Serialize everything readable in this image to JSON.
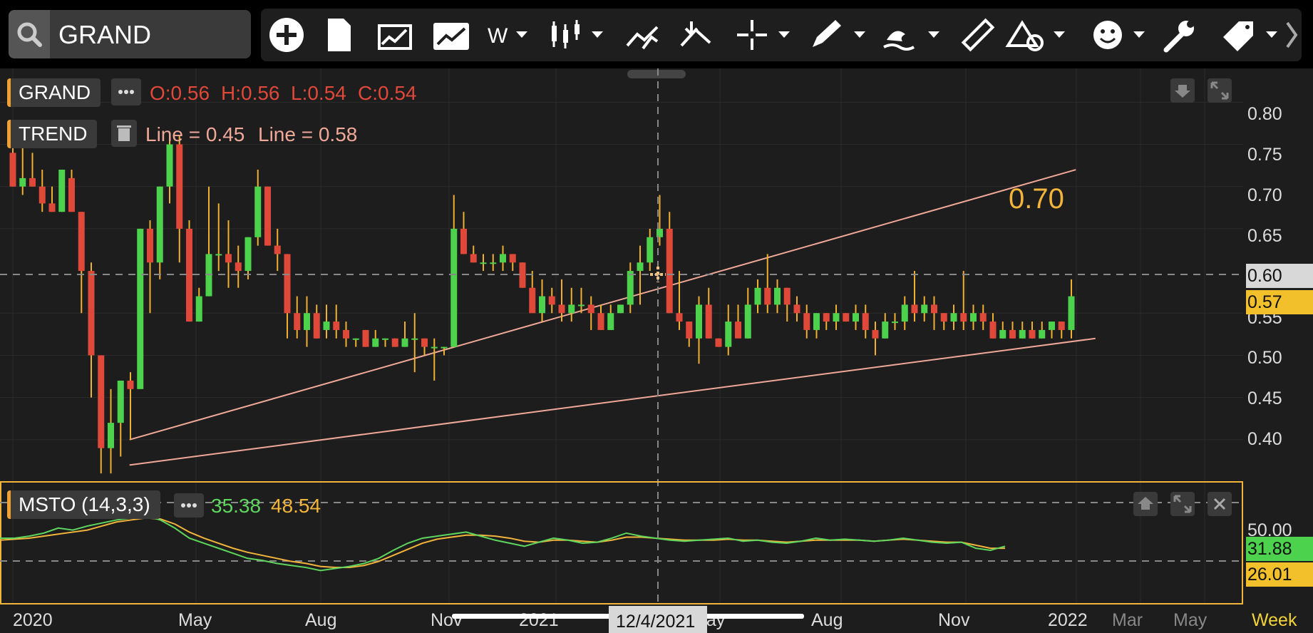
{
  "search": {
    "value": "GRAND"
  },
  "toolbar": {
    "interval": "W",
    "icons": [
      "add-icon",
      "new-document-icon",
      "compare-icon",
      "chart-overlay-icon",
      "interval-dropdown",
      "candlestick-icon",
      "indicator-icon",
      "drawing-icon",
      "crosshair-icon",
      "pencil-icon",
      "wave-icon",
      "ruler-icon",
      "shapes-icon",
      "emoji-icon",
      "wrench-icon",
      "tag-icon",
      "chevron-right-icon"
    ]
  },
  "main_legend": {
    "symbol": "GRAND",
    "open": "O:0.56",
    "high": "H:0.56",
    "low": "L:0.54",
    "close": "C:0.54"
  },
  "trend_legend": {
    "name": "TREND",
    "line1": "Line = 0.45",
    "line2": "Line = 0.58"
  },
  "annotation": "0.70",
  "price_axis": {
    "ticks": [
      "0.80",
      "0.75",
      "0.70",
      "0.65",
      "0.60",
      "0.55",
      "0.50",
      "0.45",
      "0.40"
    ],
    "crosshair_label": "0.60",
    "last_price": "0.57"
  },
  "indicator": {
    "name": "MSTO (14,3,3)",
    "k": "35.38",
    "d": "48.54",
    "axis_tick": "50.00",
    "k_last": "31.88",
    "d_last": "26.01"
  },
  "time_axis": {
    "labels": [
      "2020",
      "May",
      "Aug",
      "Nov",
      "2021",
      "May",
      "Aug",
      "Nov",
      "2022",
      "Mar",
      "May"
    ],
    "crosshair_date": "12/4/2021",
    "period": "Week"
  },
  "colors": {
    "up": "#4cd24c",
    "down": "#e0483a",
    "wick": "#f0b030",
    "trend_line": "#f0a898",
    "stoch_k": "#5ed65e",
    "stoch_d": "#f2b43a",
    "accent": "#f2b43a"
  },
  "chart_data": {
    "type": "candlestick",
    "ylim": [
      0.35,
      0.84
    ],
    "candles": [
      [
        0.74,
        0.77,
        0.7,
        0.7
      ],
      [
        0.7,
        0.75,
        0.69,
        0.71
      ],
      [
        0.71,
        0.74,
        0.7,
        0.7
      ],
      [
        0.7,
        0.72,
        0.67,
        0.68
      ],
      [
        0.68,
        0.7,
        0.67,
        0.67
      ],
      [
        0.67,
        0.72,
        0.67,
        0.72
      ],
      [
        0.71,
        0.72,
        0.67,
        0.67
      ],
      [
        0.67,
        0.67,
        0.55,
        0.6
      ],
      [
        0.6,
        0.61,
        0.45,
        0.5
      ],
      [
        0.5,
        0.45,
        0.36,
        0.39
      ],
      [
        0.39,
        0.46,
        0.36,
        0.42
      ],
      [
        0.42,
        0.47,
        0.38,
        0.47
      ],
      [
        0.47,
        0.48,
        0.4,
        0.46
      ],
      [
        0.46,
        0.65,
        0.46,
        0.65
      ],
      [
        0.65,
        0.66,
        0.55,
        0.61
      ],
      [
        0.61,
        0.7,
        0.59,
        0.7
      ],
      [
        0.7,
        0.76,
        0.68,
        0.75
      ],
      [
        0.75,
        0.76,
        0.61,
        0.65
      ],
      [
        0.65,
        0.66,
        0.54,
        0.54
      ],
      [
        0.54,
        0.58,
        0.54,
        0.57
      ],
      [
        0.57,
        0.7,
        0.57,
        0.62
      ],
      [
        0.62,
        0.68,
        0.6,
        0.62
      ],
      [
        0.62,
        0.66,
        0.58,
        0.61
      ],
      [
        0.61,
        0.63,
        0.58,
        0.6
      ],
      [
        0.6,
        0.64,
        0.59,
        0.64
      ],
      [
        0.64,
        0.72,
        0.63,
        0.7
      ],
      [
        0.7,
        0.7,
        0.63,
        0.63
      ],
      [
        0.63,
        0.65,
        0.6,
        0.62
      ],
      [
        0.62,
        0.62,
        0.52,
        0.55
      ],
      [
        0.55,
        0.57,
        0.52,
        0.53
      ],
      [
        0.53,
        0.57,
        0.51,
        0.55
      ],
      [
        0.55,
        0.56,
        0.52,
        0.52
      ],
      [
        0.53,
        0.56,
        0.52,
        0.54
      ],
      [
        0.54,
        0.56,
        0.52,
        0.53
      ],
      [
        0.53,
        0.54,
        0.51,
        0.52
      ],
      [
        0.52,
        0.52,
        0.51,
        0.52
      ],
      [
        0.53,
        0.53,
        0.51,
        0.51
      ],
      [
        0.51,
        0.53,
        0.51,
        0.52
      ],
      [
        0.52,
        0.52,
        0.51,
        0.52
      ],
      [
        0.52,
        0.52,
        0.51,
        0.51
      ],
      [
        0.51,
        0.54,
        0.51,
        0.52
      ],
      [
        0.52,
        0.55,
        0.48,
        0.52
      ],
      [
        0.52,
        0.52,
        0.5,
        0.51
      ],
      [
        0.51,
        0.52,
        0.47,
        0.51
      ],
      [
        0.51,
        0.51,
        0.5,
        0.51
      ],
      [
        0.51,
        0.69,
        0.51,
        0.65
      ],
      [
        0.65,
        0.67,
        0.62,
        0.62
      ],
      [
        0.62,
        0.63,
        0.61,
        0.61
      ],
      [
        0.61,
        0.62,
        0.6,
        0.61
      ],
      [
        0.61,
        0.62,
        0.6,
        0.61
      ],
      [
        0.61,
        0.63,
        0.6,
        0.62
      ],
      [
        0.62,
        0.62,
        0.6,
        0.61
      ],
      [
        0.61,
        0.61,
        0.58,
        0.58
      ],
      [
        0.58,
        0.6,
        0.56,
        0.55
      ],
      [
        0.55,
        0.59,
        0.54,
        0.57
      ],
      [
        0.57,
        0.58,
        0.55,
        0.56
      ],
      [
        0.56,
        0.59,
        0.54,
        0.55
      ],
      [
        0.55,
        0.58,
        0.54,
        0.56
      ],
      [
        0.56,
        0.58,
        0.55,
        0.56
      ],
      [
        0.56,
        0.57,
        0.53,
        0.55
      ],
      [
        0.55,
        0.56,
        0.53,
        0.53
      ],
      [
        0.53,
        0.56,
        0.53,
        0.55
      ],
      [
        0.55,
        0.56,
        0.55,
        0.56
      ],
      [
        0.56,
        0.61,
        0.55,
        0.6
      ],
      [
        0.6,
        0.63,
        0.56,
        0.61
      ],
      [
        0.61,
        0.65,
        0.6,
        0.64
      ],
      [
        0.64,
        0.69,
        0.63,
        0.65
      ],
      [
        0.65,
        0.67,
        0.55,
        0.55
      ],
      [
        0.55,
        0.6,
        0.53,
        0.54
      ],
      [
        0.54,
        0.54,
        0.51,
        0.52
      ],
      [
        0.52,
        0.57,
        0.49,
        0.56
      ],
      [
        0.56,
        0.58,
        0.52,
        0.52
      ],
      [
        0.52,
        0.52,
        0.51,
        0.51
      ],
      [
        0.51,
        0.56,
        0.5,
        0.54
      ],
      [
        0.54,
        0.56,
        0.53,
        0.52
      ],
      [
        0.52,
        0.58,
        0.52,
        0.56
      ],
      [
        0.56,
        0.59,
        0.55,
        0.58
      ],
      [
        0.58,
        0.62,
        0.55,
        0.56
      ],
      [
        0.56,
        0.59,
        0.55,
        0.58
      ],
      [
        0.58,
        0.58,
        0.54,
        0.56
      ],
      [
        0.56,
        0.57,
        0.54,
        0.55
      ],
      [
        0.55,
        0.56,
        0.52,
        0.53
      ],
      [
        0.53,
        0.55,
        0.52,
        0.55
      ],
      [
        0.55,
        0.55,
        0.53,
        0.54
      ],
      [
        0.54,
        0.56,
        0.53,
        0.55
      ],
      [
        0.55,
        0.55,
        0.54,
        0.54
      ],
      [
        0.54,
        0.56,
        0.53,
        0.55
      ],
      [
        0.55,
        0.56,
        0.52,
        0.53
      ],
      [
        0.53,
        0.54,
        0.5,
        0.52
      ],
      [
        0.52,
        0.55,
        0.52,
        0.54
      ],
      [
        0.54,
        0.55,
        0.53,
        0.54
      ],
      [
        0.54,
        0.57,
        0.53,
        0.56
      ],
      [
        0.56,
        0.6,
        0.54,
        0.55
      ],
      [
        0.55,
        0.57,
        0.54,
        0.56
      ],
      [
        0.56,
        0.57,
        0.53,
        0.55
      ],
      [
        0.55,
        0.55,
        0.53,
        0.54
      ],
      [
        0.54,
        0.56,
        0.53,
        0.55
      ],
      [
        0.55,
        0.6,
        0.53,
        0.54
      ],
      [
        0.54,
        0.56,
        0.53,
        0.55
      ],
      [
        0.55,
        0.56,
        0.53,
        0.54
      ],
      [
        0.54,
        0.55,
        0.52,
        0.52
      ],
      [
        0.52,
        0.54,
        0.52,
        0.53
      ],
      [
        0.53,
        0.54,
        0.52,
        0.52
      ],
      [
        0.52,
        0.54,
        0.52,
        0.53
      ],
      [
        0.53,
        0.54,
        0.52,
        0.52
      ],
      [
        0.52,
        0.54,
        0.52,
        0.53
      ],
      [
        0.53,
        0.54,
        0.52,
        0.54
      ],
      [
        0.54,
        0.54,
        0.52,
        0.53
      ],
      [
        0.53,
        0.59,
        0.52,
        0.57
      ]
    ],
    "trend_lines": [
      {
        "from": [
          9,
          0.4
        ],
        "to": [
          103,
          0.72
        ]
      },
      {
        "from": [
          9,
          0.37
        ],
        "to": [
          105,
          0.52
        ]
      }
    ],
    "stoch_ylim": [
      0,
      100
    ],
    "stoch_k": [
      60,
      60,
      62,
      65,
      70,
      68,
      72,
      75,
      78,
      80,
      82,
      78,
      70,
      60,
      55,
      50,
      45,
      40,
      38,
      35,
      33,
      31,
      28,
      30,
      32,
      35,
      40,
      48,
      55,
      60,
      62,
      64,
      66,
      62,
      58,
      55,
      52,
      56,
      60,
      58,
      55,
      56,
      60,
      65,
      62,
      60,
      58,
      57,
      58,
      59,
      60,
      57,
      58,
      56,
      55,
      57,
      60,
      58,
      59,
      58,
      57,
      58,
      60,
      58,
      56,
      55,
      56,
      50,
      48,
      52
    ],
    "stoch_d": [
      58,
      59,
      60,
      62,
      64,
      66,
      68,
      72,
      76,
      78,
      80,
      79,
      74,
      66,
      60,
      55,
      50,
      46,
      43,
      40,
      37,
      35,
      32,
      31,
      31,
      33,
      37,
      43,
      49,
      55,
      59,
      61,
      63,
      63,
      62,
      60,
      57,
      56,
      58,
      58,
      57,
      56,
      58,
      61,
      61,
      60,
      59,
      58,
      58,
      58,
      59,
      58,
      58,
      57,
      56,
      57,
      58,
      58,
      58,
      58,
      57,
      58,
      59,
      58,
      57,
      56,
      56,
      53,
      50,
      50
    ]
  }
}
